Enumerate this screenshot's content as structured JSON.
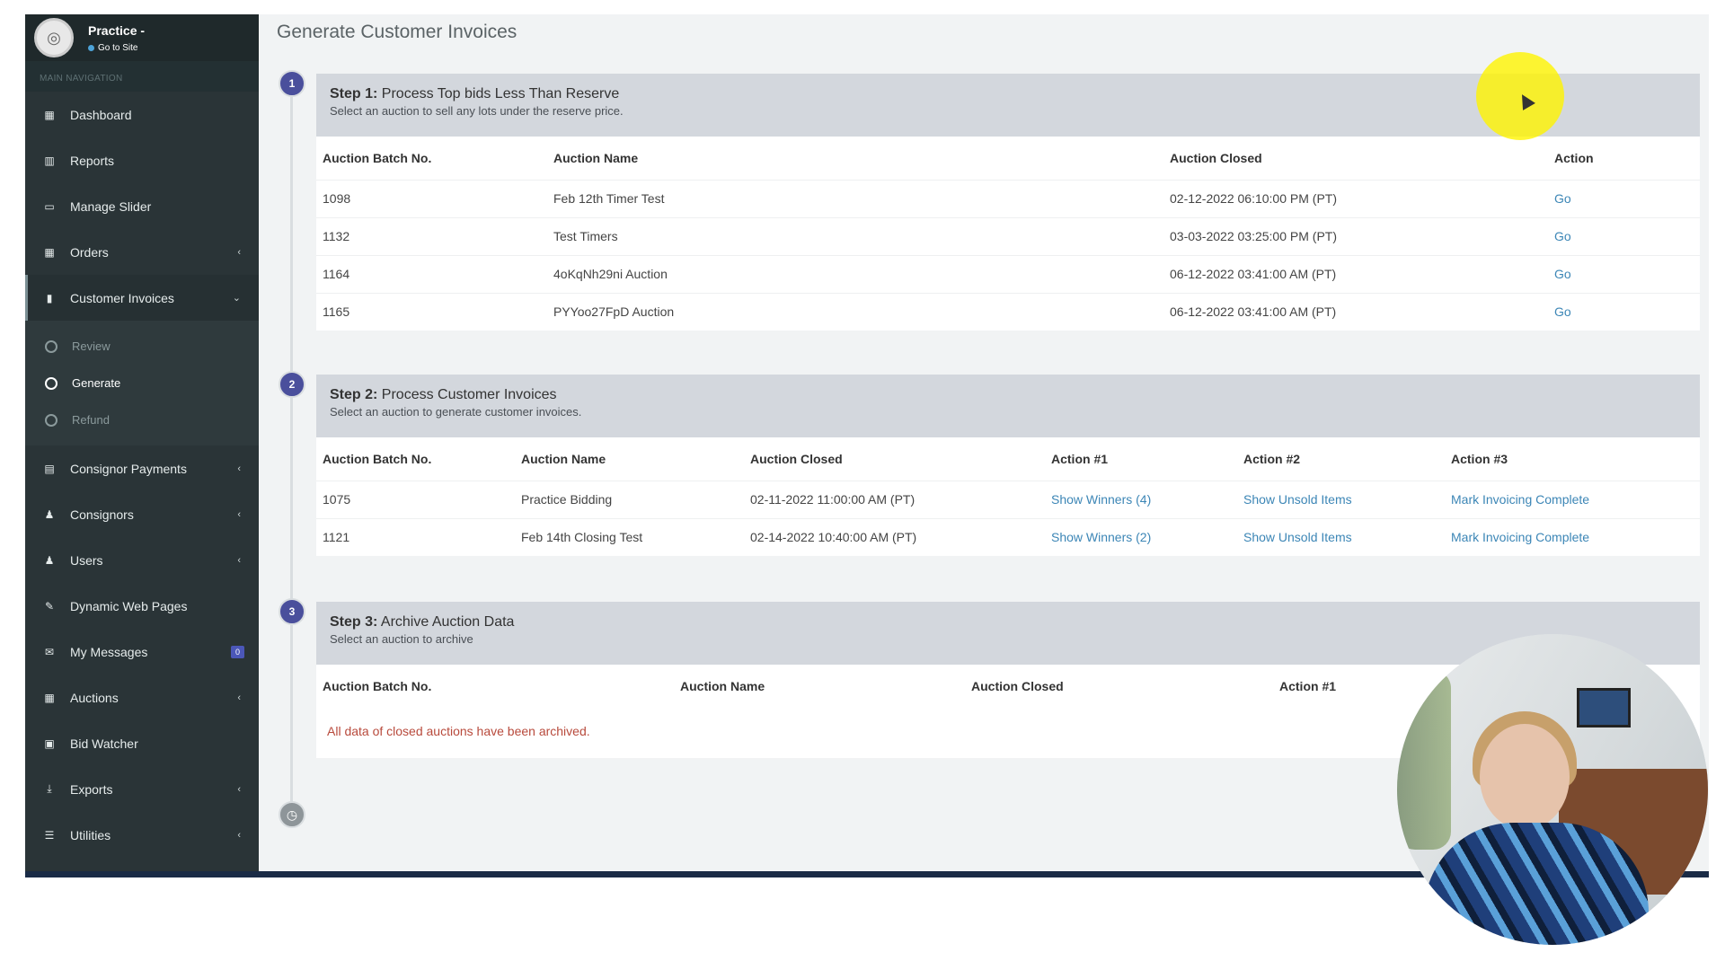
{
  "sidebar": {
    "brand_title": "Practice -",
    "brand_link": "Go to Site",
    "section_header": "MAIN NAVIGATION",
    "items": [
      {
        "label": "Dashboard",
        "icon": "dashboard-icon",
        "glyph": "▦"
      },
      {
        "label": "Reports",
        "icon": "bar-chart-icon",
        "glyph": "▥"
      },
      {
        "label": "Manage Slider",
        "icon": "image-icon",
        "glyph": "▭"
      },
      {
        "label": "Orders",
        "icon": "grid-icon",
        "glyph": "▦",
        "chev": "‹"
      },
      {
        "label": "Customer Invoices",
        "icon": "invoice-icon",
        "glyph": "▮",
        "chev": "⌄"
      }
    ],
    "submenu": [
      {
        "label": "Review"
      },
      {
        "label": "Generate"
      },
      {
        "label": "Refund"
      }
    ],
    "items_after": [
      {
        "label": "Consignor Payments",
        "icon": "file-icon",
        "glyph": "▤",
        "chev": "‹"
      },
      {
        "label": "Consignors",
        "icon": "users-icon",
        "glyph": "♟",
        "chev": "‹"
      },
      {
        "label": "Users",
        "icon": "group-icon",
        "glyph": "♟",
        "chev": "‹"
      },
      {
        "label": "Dynamic Web Pages",
        "icon": "magic-wand-icon",
        "glyph": "✎"
      },
      {
        "label": "My Messages",
        "icon": "envelope-icon",
        "glyph": "✉",
        "badge": "0"
      },
      {
        "label": "Auctions",
        "icon": "calendar-icon",
        "glyph": "▦",
        "chev": "‹"
      },
      {
        "label": "Bid Watcher",
        "icon": "monitor-icon",
        "glyph": "▣"
      },
      {
        "label": "Exports",
        "icon": "download-icon",
        "glyph": "⤓",
        "chev": "‹"
      },
      {
        "label": "Utilities",
        "icon": "list-icon",
        "glyph": "☰",
        "chev": "‹"
      }
    ]
  },
  "main": {
    "page_title": "Generate Customer Invoices",
    "steps": [
      {
        "num": "1",
        "title_prefix": "Step 1:",
        "title": "Process Top bids Less Than Reserve",
        "subtitle": "Select an auction to sell any lots under the reserve price.",
        "headers": [
          "Auction Batch No.",
          "Auction Name",
          "Auction Closed",
          "Action"
        ],
        "rows": [
          [
            "1098",
            "Feb 12th Timer Test",
            "02-12-2022 06:10:00 PM (PT)",
            "Go"
          ],
          [
            "1132",
            "Test Timers",
            "03-03-2022 03:25:00 PM (PT)",
            "Go"
          ],
          [
            "1164",
            "4oKqNh29ni Auction",
            "06-12-2022 03:41:00 AM (PT)",
            "Go"
          ],
          [
            "1165",
            "PYYoo27FpD Auction",
            "06-12-2022 03:41:00 AM (PT)",
            "Go"
          ]
        ]
      },
      {
        "num": "2",
        "title_prefix": "Step 2:",
        "title": "Process Customer Invoices",
        "subtitle": "Select an auction to generate customer invoices.",
        "headers": [
          "Auction Batch No.",
          "Auction Name",
          "Auction Closed",
          "Action #1",
          "Action #2",
          "Action #3"
        ],
        "rows": [
          [
            "1075",
            "Practice Bidding",
            "02-11-2022 11:00:00 AM (PT)",
            "Show Winners (4)",
            "Show Unsold Items",
            "Mark Invoicing Complete"
          ],
          [
            "1121",
            "Feb 14th Closing Test",
            "02-14-2022 10:40:00 AM (PT)",
            "Show Winners (2)",
            "Show Unsold Items",
            "Mark Invoicing Complete"
          ]
        ]
      },
      {
        "num": "3",
        "title_prefix": "Step 3:",
        "title": "Archive Auction Data",
        "subtitle": "Select an auction to archive",
        "headers": [
          "Auction Batch No.",
          "Auction Name",
          "Auction Closed",
          "Action #1"
        ],
        "empty_message": "All data of closed auctions have been archived."
      }
    ]
  },
  "colors": {
    "sidebar_bg": "#2a3437",
    "step_badge": "#4a4f9c",
    "link": "#3c86b6",
    "empty_text": "#b84a3c",
    "cursor_highlight": "#fff400"
  }
}
